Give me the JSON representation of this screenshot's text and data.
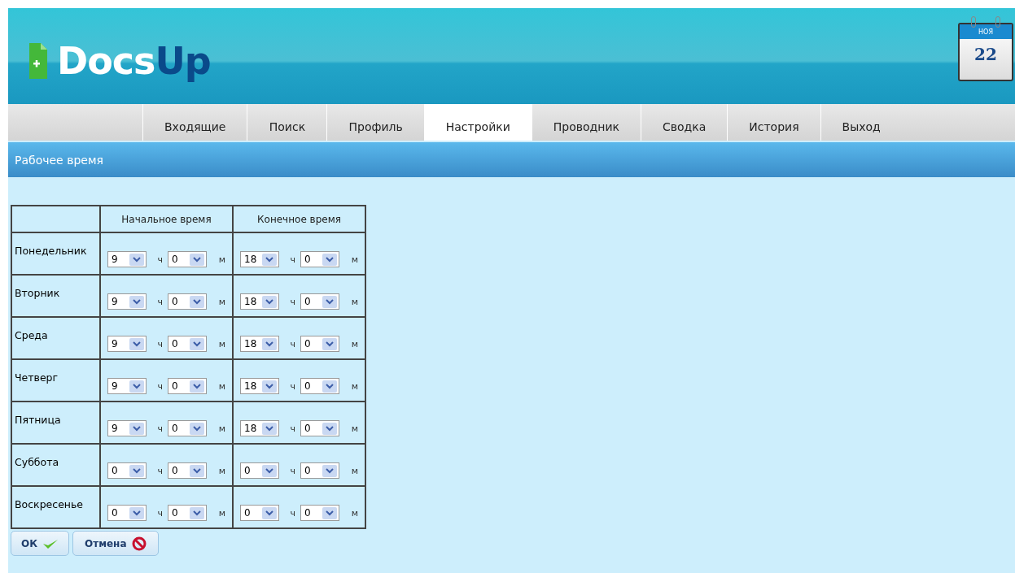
{
  "header": {
    "logo": {
      "part_1": "Docs",
      "part_2": "Up"
    },
    "calendar": {
      "month": "НОЯ",
      "day": "22"
    }
  },
  "tabs": [
    {
      "label": "Входящие",
      "selected": false
    },
    {
      "label": "Поиск",
      "selected": false
    },
    {
      "label": "Профиль",
      "selected": false
    },
    {
      "label": "Настройки",
      "selected": true
    },
    {
      "label": "Проводник",
      "selected": false
    },
    {
      "label": "Сводка",
      "selected": false
    },
    {
      "label": "История",
      "selected": false
    },
    {
      "label": "Выход",
      "selected": false
    }
  ],
  "section": {
    "title": "Рабочее время"
  },
  "table": {
    "columns": [
      "Начальное время",
      "Конечное время"
    ],
    "rows": [
      {
        "day": "Понедельник",
        "start": [
          {
            "value": "9",
            "unit": "ч"
          },
          {
            "value": "0",
            "unit": "м"
          }
        ],
        "end": [
          {
            "value": "18",
            "unit": "ч"
          },
          {
            "value": "0",
            "unit": "м"
          }
        ]
      },
      {
        "day": "Вторник",
        "start": [
          {
            "value": "9",
            "unit": "ч"
          },
          {
            "value": "0",
            "unit": "м"
          }
        ],
        "end": [
          {
            "value": "18",
            "unit": "ч"
          },
          {
            "value": "0",
            "unit": "м"
          }
        ]
      },
      {
        "day": "Среда",
        "start": [
          {
            "value": "9",
            "unit": "ч"
          },
          {
            "value": "0",
            "unit": "м"
          }
        ],
        "end": [
          {
            "value": "18",
            "unit": "ч"
          },
          {
            "value": "0",
            "unit": "м"
          }
        ]
      },
      {
        "day": "Четверг",
        "start": [
          {
            "value": "9",
            "unit": "ч"
          },
          {
            "value": "0",
            "unit": "м"
          }
        ],
        "end": [
          {
            "value": "18",
            "unit": "ч"
          },
          {
            "value": "0",
            "unit": "м"
          }
        ]
      },
      {
        "day": "Пятница",
        "start": [
          {
            "value": "9",
            "unit": "ч"
          },
          {
            "value": "0",
            "unit": "м"
          }
        ],
        "end": [
          {
            "value": "18",
            "unit": "ч"
          },
          {
            "value": "0",
            "unit": "м"
          }
        ]
      },
      {
        "day": "Суббота",
        "start": [
          {
            "value": "0",
            "unit": "ч"
          },
          {
            "value": "0",
            "unit": "м"
          }
        ],
        "end": [
          {
            "value": "0",
            "unit": "ч"
          },
          {
            "value": "0",
            "unit": "м"
          }
        ]
      },
      {
        "day": "Воскресенье",
        "start": [
          {
            "value": "0",
            "unit": "ч"
          },
          {
            "value": "0",
            "unit": "м"
          }
        ],
        "end": [
          {
            "value": "0",
            "unit": "ч"
          },
          {
            "value": "0",
            "unit": "м"
          }
        ]
      }
    ]
  },
  "buttons": [
    {
      "label": "ОК",
      "kind": "ok"
    },
    {
      "label": "Отмена",
      "kind": "cancel"
    }
  ]
}
